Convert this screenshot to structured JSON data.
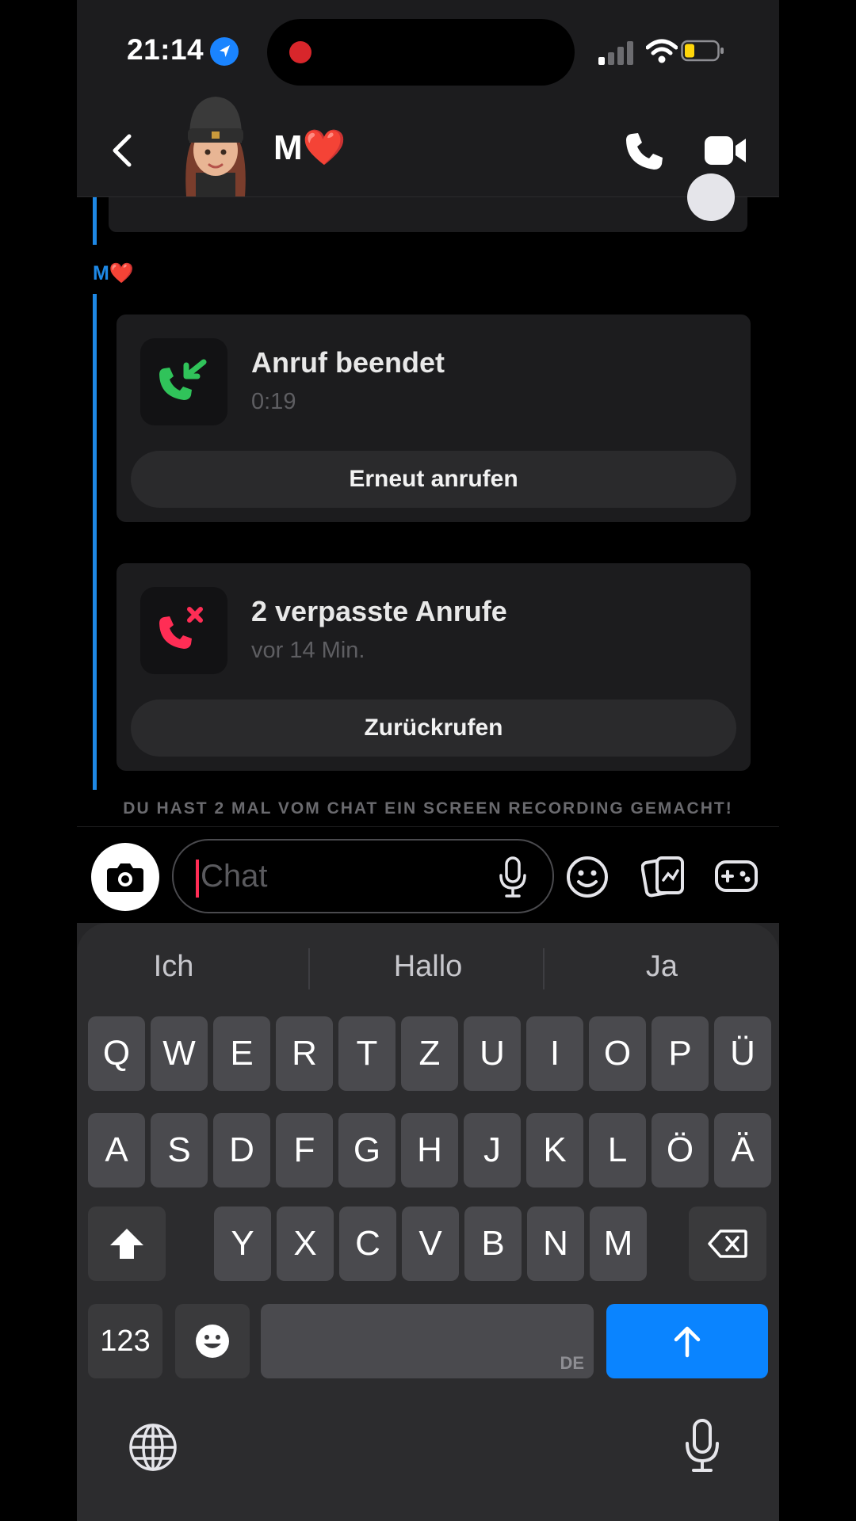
{
  "status_bar": {
    "time": "21:14"
  },
  "header": {
    "contact_name": "M❤️"
  },
  "chat": {
    "sender": "M❤️",
    "cards": [
      {
        "title": "Anruf beendet",
        "subtitle": "0:19",
        "button": "Erneut anrufen",
        "icon": "incoming-call-icon",
        "icon_color": "#30c35a"
      },
      {
        "title": "2 verpasste Anrufe",
        "subtitle": "vor 14 Min.",
        "button": "Zurückrufen",
        "icon": "missed-call-icon",
        "icon_color": "#ff2d55"
      }
    ],
    "recording_notice": "DU HAST 2 MAL VOM CHAT EIN SCREEN RECORDING GEMACHT!"
  },
  "input": {
    "placeholder": "Chat"
  },
  "keyboard": {
    "suggestions": [
      "Ich",
      "Hallo",
      "Ja"
    ],
    "row1": [
      "Q",
      "W",
      "E",
      "R",
      "T",
      "Z",
      "U",
      "I",
      "O",
      "P",
      "Ü"
    ],
    "row2": [
      "A",
      "S",
      "D",
      "F",
      "G",
      "H",
      "J",
      "K",
      "L",
      "Ö",
      "Ä"
    ],
    "row3": [
      "Y",
      "X",
      "C",
      "V",
      "B",
      "N",
      "M"
    ],
    "numbers_key": "123",
    "space_lang": "DE"
  },
  "colors": {
    "accent": "#0a84ff",
    "thread": "#1e88e5",
    "missed": "#ff2d55",
    "answered": "#30c35a"
  }
}
